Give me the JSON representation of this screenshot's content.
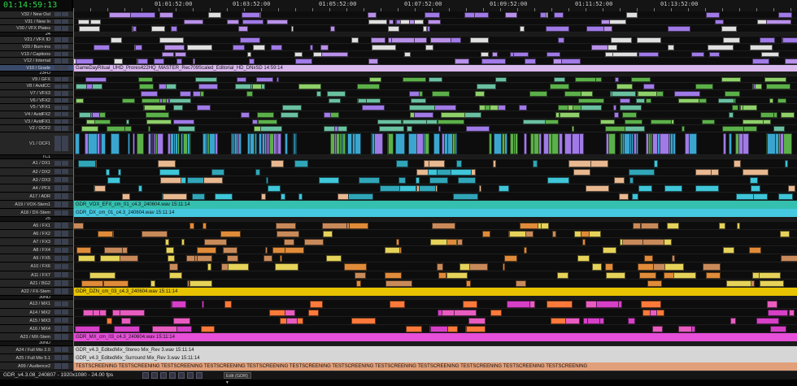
{
  "timecode": "01:14:59:13",
  "ruler_labels": [
    "01:01:52:00",
    "01:03:52:00",
    "01:05:52:00",
    "01:07:52:00",
    "01:09:52:00",
    "01:11:52:00",
    "01:13:52:00"
  ],
  "tracks": [
    {
      "label": "V32 / New Out",
      "kind": "v"
    },
    {
      "label": "V31 / New In",
      "kind": "v"
    },
    {
      "label": "V30 / VFX Plates",
      "kind": "v"
    },
    {
      "label": "24",
      "kind": "sep"
    },
    {
      "label": "V21 / VFX ID",
      "kind": "v"
    },
    {
      "label": "V20 / Burn-ins",
      "kind": "v"
    },
    {
      "label": "V13 / Captions",
      "kind": "v"
    },
    {
      "label": "V12 / Internal",
      "kind": "v"
    },
    {
      "label": "V10 / Grade",
      "kind": "v",
      "selected": true
    },
    {
      "label": "23FD",
      "kind": "sep"
    },
    {
      "label": "V9 / GFX",
      "kind": "v"
    },
    {
      "label": "V8 / AvidCC",
      "kind": "v"
    },
    {
      "label": "V7 / VFX3",
      "kind": "v"
    },
    {
      "label": "V6 / VFX2",
      "kind": "v"
    },
    {
      "label": "V5 / VFX1",
      "kind": "v"
    },
    {
      "label": "V4 / AvidFX2",
      "kind": "v"
    },
    {
      "label": "V3 / AvidFX1",
      "kind": "v"
    },
    {
      "label": "V2 / OCF2",
      "kind": "v"
    },
    {
      "label": "V1 / OCF1",
      "kind": "v1"
    },
    {
      "label": "TC1",
      "kind": "sep"
    },
    {
      "label": "A1 / DX1",
      "kind": "a"
    },
    {
      "label": "A2 / DX2",
      "kind": "a"
    },
    {
      "label": "A3 / DX3",
      "kind": "a"
    },
    {
      "label": "A4 / PFX",
      "kind": "a"
    },
    {
      "label": "A17 / ADR",
      "kind": "a"
    },
    {
      "label": "A19 / VOX-Stem1",
      "kind": "a"
    },
    {
      "label": "A18 / DX-Stem",
      "kind": "a"
    },
    {
      "label": "25",
      "kind": "sep"
    },
    {
      "label": "A5 / FX1",
      "kind": "a"
    },
    {
      "label": "A6 / FX2",
      "kind": "a"
    },
    {
      "label": "A7 / FX3",
      "kind": "a"
    },
    {
      "label": "A8 / FX4",
      "kind": "a"
    },
    {
      "label": "A9 / FX5",
      "kind": "a"
    },
    {
      "label": "A10 / FX6",
      "kind": "a"
    },
    {
      "label": "A11 / FX7",
      "kind": "a"
    },
    {
      "label": "A21 / BG2",
      "kind": "a"
    },
    {
      "label": "A22 / FX-Stem",
      "kind": "a"
    },
    {
      "label": "30ND",
      "kind": "sep"
    },
    {
      "label": "A13 / MX1",
      "kind": "a"
    },
    {
      "label": "A14 / MX2",
      "kind": "a"
    },
    {
      "label": "A15 / MX3",
      "kind": "a"
    },
    {
      "label": "A16 / MX4",
      "kind": "a"
    },
    {
      "label": "A23 / MX-Stem",
      "kind": "a"
    },
    {
      "label": "30ND",
      "kind": "sep"
    },
    {
      "label": "A24 / Full Mix 2.0",
      "kind": "a"
    },
    {
      "label": "A25 / Full Mix 5.1",
      "kind": "a"
    },
    {
      "label": "A99 / Audience2",
      "kind": "a"
    }
  ],
  "long_clips": [
    {
      "text": "GameDayRitual_UHD_Prores422HQ_MASTER_Rec709Scaled_Editorial_HD_DNxSD 14:59:14",
      "color": "#d9b8ee"
    },
    {
      "text": "GDR_VOX_EFX_cm_01_c4.3_240604.wav 15:11:14",
      "color": "#35bfae"
    },
    {
      "text": "GDR_DX_cm_01_c4.3_240604.wav 15:11:14",
      "color": "#45c9e0"
    },
    {
      "text": "GDR_DZN_cm_03_c4.3_240604.wav 15:11:14",
      "color": "#e8c400"
    },
    {
      "text": "GDR_MX_cm_03_c4.3_240604.wav 15:11:14",
      "color": "#e64fd8"
    },
    {
      "text": "GDR_v4.3_EditedMix_Stereo Mix_Rev 3.wav 15:11:14",
      "color": "#d6d6d6"
    },
    {
      "text": "GDR_v4.3_EditedMix_Surround Mix_Rev 3.wav 15:11:14",
      "color": "#d6d6d6"
    },
    {
      "text": "TESTSCREENING TESTSCREENING TESTSCREENING TESTSCREENING TESTSCREENING TESTSCREENING TESTSCREENING TESTSCREENING TESTSCREENING TESTSCREENING TESTSCREENING TESTSCREENING",
      "color": "#e2a07a"
    }
  ],
  "status": {
    "info": "GDR_v4.3.08_240807 - 1920x1080 - 24.00 fps",
    "mode": "Edit (GDR) ▾"
  },
  "colors": {
    "video_green": "#5cb04a",
    "video_cyan": "#3aa6d0",
    "vfx_purple": "#a07ae6",
    "audio_teal": "#31a6b8",
    "fx_orange": "#e08b3a",
    "music_magenta": "#d640c7",
    "playhead": "#ff3333",
    "timecode": "#2dd84a"
  }
}
